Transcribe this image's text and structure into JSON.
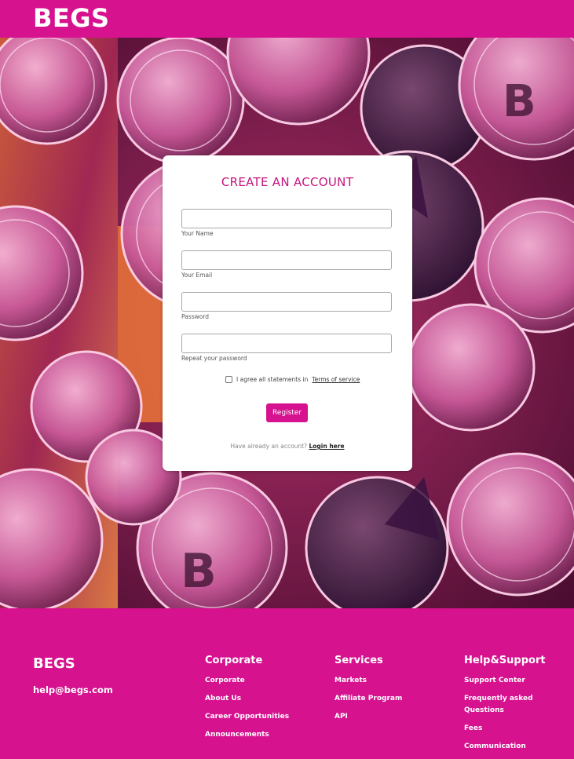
{
  "header": {
    "logo": "BEGS"
  },
  "form": {
    "title": "CREATE AN ACCOUNT",
    "fields": [
      {
        "label": "Your Name",
        "value": ""
      },
      {
        "label": "Your Email",
        "value": ""
      },
      {
        "label": "Password",
        "value": ""
      },
      {
        "label": "Repeat your password",
        "value": ""
      }
    ],
    "agree_text": "I agree all statements in",
    "terms_link": "Terms of service",
    "agree_checked": false,
    "register_label": "Register",
    "login_prompt": "Have already an account?",
    "login_link": "Login here"
  },
  "footer": {
    "brand": "BEGS",
    "email": "help@begs.com",
    "columns": [
      {
        "title": "Corporate",
        "links": [
          "Corporate",
          "About Us",
          "Career Opportunities",
          "Announcements"
        ]
      },
      {
        "title": "Services",
        "links": [
          "Markets",
          "Affiliate Program",
          "API"
        ]
      },
      {
        "title": "Help&Support",
        "links": [
          "Support Center",
          "Frequently asked Questions",
          "Fees",
          "Communication"
        ]
      }
    ]
  },
  "colors": {
    "brand": "#d6128f",
    "title": "#c4147f"
  }
}
